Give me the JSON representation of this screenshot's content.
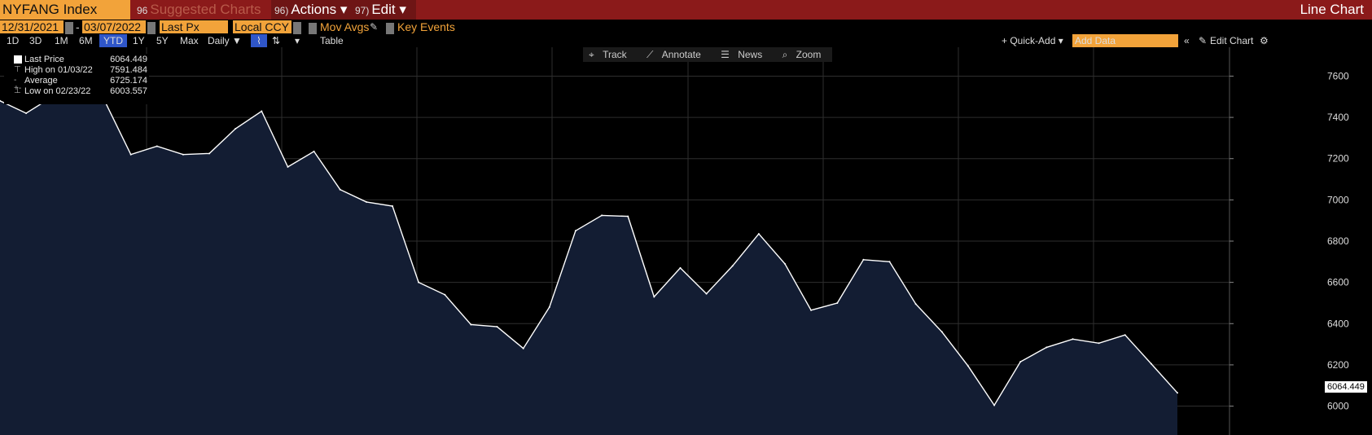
{
  "header": {
    "ticker": "NYFANG Index",
    "suggested": "Suggested Charts",
    "suggested_num": "96",
    "actions_num": "96)",
    "actions": "Actions ▾",
    "edit_num": "97)",
    "edit": "Edit ▾",
    "chart_type": "Line Chart"
  },
  "controls": {
    "start_date": "12/31/2021",
    "end_date": "03/07/2022",
    "field": "Last Px",
    "currency": "Local CCY",
    "mov_avgs": "Mov Avgs",
    "key_events": "Key Events",
    "periods": [
      "1D",
      "3D",
      "1M",
      "6M",
      "YTD",
      "1Y",
      "5Y",
      "Max"
    ],
    "frequency": "Daily ▼",
    "table": "Table",
    "quick_add": "+ Quick-Add ▾",
    "add_data_placeholder": "Add Data",
    "edit_chart": "Edit Chart"
  },
  "tools": [
    "Track",
    "Annotate",
    "News",
    "Zoom"
  ],
  "legend": [
    {
      "label": "Last Price",
      "value": "6064.449"
    },
    {
      "label": "High on 01/03/22",
      "value": "7591.484"
    },
    {
      "label": "Average",
      "value": "6725.174"
    },
    {
      "label": "Low on 02/23/22",
      "value": "6003.557"
    }
  ],
  "last_value_label": "6064.449",
  "colors": {
    "area": "#131d33",
    "line": "#ffffff",
    "header": "#8b1a1a",
    "accent": "#f2a33a",
    "active": "#2f56c9"
  },
  "chart_data": {
    "type": "area",
    "series": [
      {
        "values": [
          7480,
          7420,
          7500,
          7560,
          7480,
          7220,
          7260,
          7220,
          7225,
          7345,
          7430,
          7160,
          7235,
          7050,
          6990,
          6970,
          6600,
          6540,
          6395,
          6385,
          6280,
          6480,
          6850,
          6925,
          6920,
          6530,
          6670,
          6545,
          6680,
          6835,
          6690,
          6465,
          6500,
          6710,
          6700,
          6495,
          6360,
          6195,
          6004,
          6215,
          6285,
          6325,
          6305,
          6345,
          6205,
          6064
        ]
      }
    ],
    "ylim": [
      5860,
      7740
    ],
    "yticks": [
      6000,
      6200,
      6400,
      6600,
      6800,
      7000,
      7200,
      7400,
      7600
    ],
    "grid": true,
    "legend": "top-left"
  }
}
